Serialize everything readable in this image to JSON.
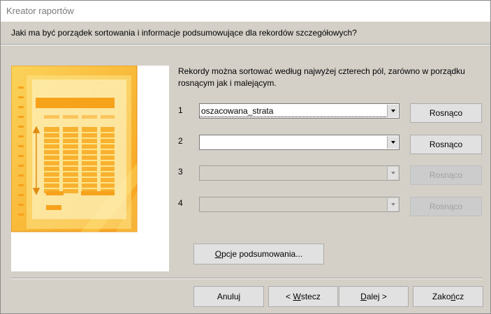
{
  "window": {
    "title": "Kreator raportów"
  },
  "question": "Jaki ma być porządek sortowania i informacje podsumowujące dla rekordów szczegółowych?",
  "description": "Rekordy można sortować według najwyżej czterech pól, zarówno w porządku rosnącym jak i malejącym.",
  "sort_rows": [
    {
      "num": "1",
      "field": "oszacowana_strata",
      "order": "Rosnąco",
      "enabled": true
    },
    {
      "num": "2",
      "field": "",
      "order": "Rosnąco",
      "enabled": true
    },
    {
      "num": "3",
      "field": "",
      "order": "Rosnąco",
      "enabled": false
    },
    {
      "num": "4",
      "field": "",
      "order": "Rosnąco",
      "enabled": false
    }
  ],
  "summary_button": {
    "mnemonic": "O",
    "rest": "pcje podsumowania..."
  },
  "footer": {
    "cancel": "Anuluj",
    "back": {
      "pre": "< ",
      "mnemonic": "W",
      "rest": "stecz"
    },
    "next": {
      "mnemonic": "D",
      "rest": "alej >"
    },
    "finish": {
      "pre": "Zako",
      "mnemonic": "ń",
      "rest": "cz"
    }
  },
  "colors": {
    "preview_orange": "#f7a21b",
    "preview_yellow": "#fde58a",
    "preview_light": "#fff3c4"
  },
  "icons": [
    "report-preview-image",
    "dropdown-arrow-icon"
  ]
}
